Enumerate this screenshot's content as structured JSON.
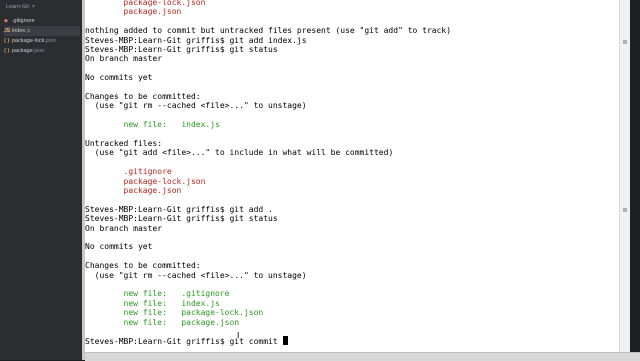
{
  "sidebar": {
    "project_title": "Learn-Git",
    "items": [
      {
        "icon": "diamond-icon",
        "name": ".gitignore",
        "ext": ""
      },
      {
        "icon": "js-icon",
        "name": "index",
        "ext": ".js",
        "active": true
      },
      {
        "icon": "json-icon",
        "name": "package-lock",
        "ext": ".json"
      },
      {
        "icon": "json-icon",
        "name": "package",
        "ext": ".json"
      }
    ]
  },
  "terminal": {
    "lines": [
      {
        "indent": "        ",
        "text": "package-lock.json",
        "color": "red"
      },
      {
        "indent": "        ",
        "text": "package.json",
        "color": "red"
      },
      {
        "indent": "",
        "text": "",
        "color": "black"
      },
      {
        "indent": "",
        "text": "nothing added to commit but untracked files present (use \"git add\" to track)",
        "color": "black"
      },
      {
        "indent": "",
        "text": "Steves-MBP:Learn-Git griffis$ git add index.js",
        "color": "black"
      },
      {
        "indent": "",
        "text": "Steves-MBP:Learn-Git griffis$ git status",
        "color": "black"
      },
      {
        "indent": "",
        "text": "On branch master",
        "color": "black"
      },
      {
        "indent": "",
        "text": "",
        "color": "black"
      },
      {
        "indent": "",
        "text": "No commits yet",
        "color": "black"
      },
      {
        "indent": "",
        "text": "",
        "color": "black"
      },
      {
        "indent": "",
        "text": "Changes to be committed:",
        "color": "black"
      },
      {
        "indent": "  ",
        "text": "(use \"git rm --cached <file>...\" to unstage)",
        "color": "black"
      },
      {
        "indent": "",
        "text": "",
        "color": "black"
      },
      {
        "indent": "        ",
        "text": "new file:   index.js",
        "color": "green"
      },
      {
        "indent": "",
        "text": "",
        "color": "black"
      },
      {
        "indent": "",
        "text": "Untracked files:",
        "color": "black"
      },
      {
        "indent": "  ",
        "text": "(use \"git add <file>...\" to include in what will be committed)",
        "color": "black"
      },
      {
        "indent": "",
        "text": "",
        "color": "black"
      },
      {
        "indent": "        ",
        "text": ".gitignore",
        "color": "red"
      },
      {
        "indent": "        ",
        "text": "package-lock.json",
        "color": "red"
      },
      {
        "indent": "        ",
        "text": "package.json",
        "color": "red"
      },
      {
        "indent": "",
        "text": "",
        "color": "black"
      },
      {
        "indent": "",
        "text": "Steves-MBP:Learn-Git griffis$ git add .",
        "color": "black"
      },
      {
        "indent": "",
        "text": "Steves-MBP:Learn-Git griffis$ git status",
        "color": "black"
      },
      {
        "indent": "",
        "text": "On branch master",
        "color": "black"
      },
      {
        "indent": "",
        "text": "",
        "color": "black"
      },
      {
        "indent": "",
        "text": "No commits yet",
        "color": "black"
      },
      {
        "indent": "",
        "text": "",
        "color": "black"
      },
      {
        "indent": "",
        "text": "Changes to be committed:",
        "color": "black"
      },
      {
        "indent": "  ",
        "text": "(use \"git rm --cached <file>...\" to unstage)",
        "color": "black"
      },
      {
        "indent": "",
        "text": "",
        "color": "black"
      },
      {
        "indent": "        ",
        "text": "new file:   .gitignore",
        "color": "green"
      },
      {
        "indent": "        ",
        "text": "new file:   index.js",
        "color": "green"
      },
      {
        "indent": "        ",
        "text": "new file:   package-lock.json",
        "color": "green"
      },
      {
        "indent": "        ",
        "text": "new file:   package.json",
        "color": "green"
      },
      {
        "indent": "",
        "text": "",
        "color": "black"
      },
      {
        "indent": "",
        "text": "Steves-MBP:Learn-Git griffis$ git commit ",
        "color": "black",
        "cursor": true
      }
    ]
  },
  "colors": {
    "red": "#b8241a",
    "green": "#2b9a20",
    "black": "#000000"
  }
}
